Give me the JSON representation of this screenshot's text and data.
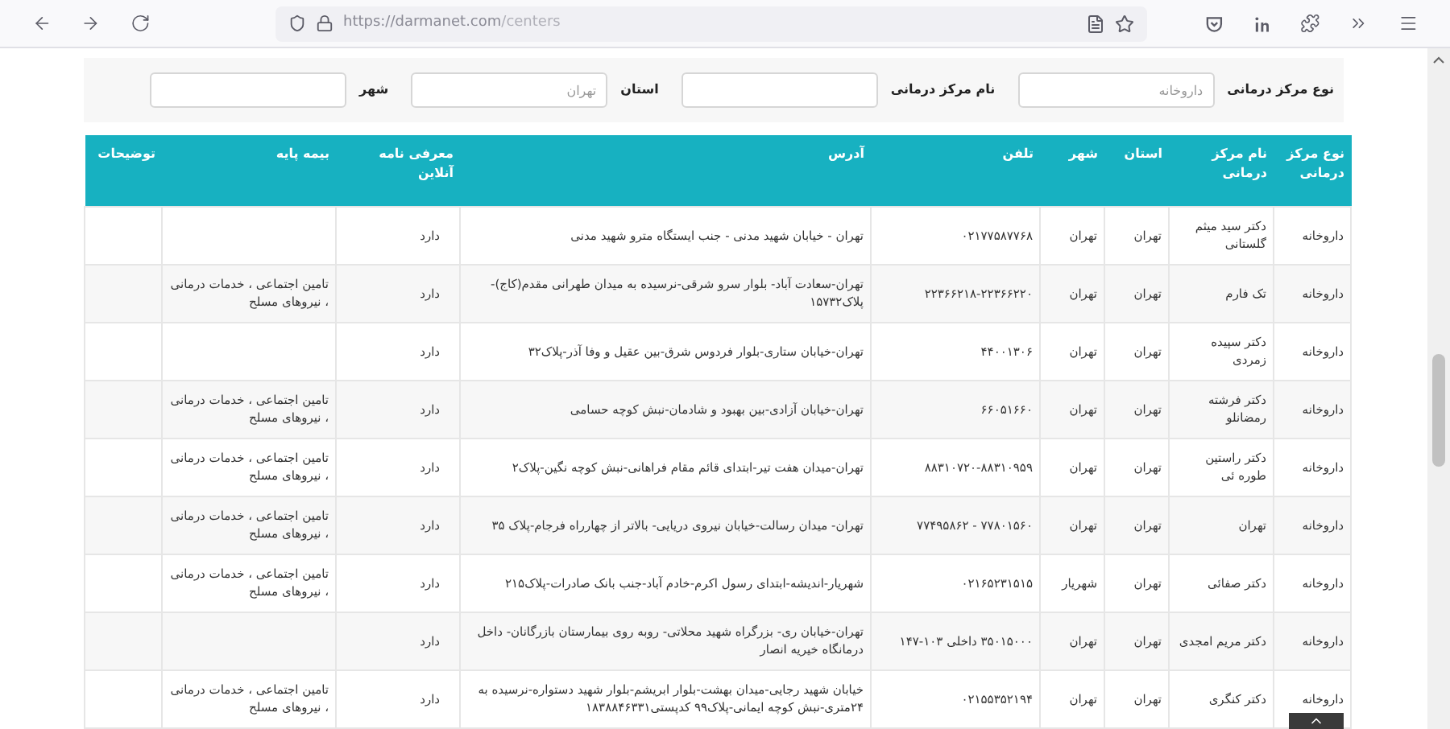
{
  "browser": {
    "url_host": "https://darmanet.com",
    "url_path": "/centers"
  },
  "filters": [
    {
      "label": "نوع مرکز درمانی",
      "placeholder": "داروخانه"
    },
    {
      "label": "نام مرکز درمانی"
    },
    {
      "label": "استان",
      "placeholder": "تهران"
    },
    {
      "label": "شهر"
    }
  ],
  "table": {
    "columns": [
      "نوع مرکز درمانی",
      "نام مرکز درمانی",
      "استان",
      "شهر",
      "تلفن",
      "آدرس",
      "معرفی نامه آنلاین",
      "بیمه پایه",
      "توضیحات"
    ],
    "rows": [
      {
        "type": "داروخانه",
        "name": "دکتر سید میثم گلستانی",
        "province": "تهران",
        "city": "تهران",
        "phone": "۰۲۱۷۷۵۸۷۷۶۸",
        "address": "تهران - خیابان شهید مدنی - جنب ایستگاه مترو شهید مدنی",
        "online": "دارد"
      },
      {
        "type": "داروخانه",
        "name": "تک فارم",
        "province": "تهران",
        "city": "تهران",
        "phone": "۲۲۳۶۶۲۱۸-۲۲۳۶۶۲۲۰",
        "address": "تهران-سعادت آباد- بلوار سرو شرقی-نرسیده به میدان طهرانی مقدم(کاج)-پلاک۱۵۷۳۲",
        "online": "دارد",
        "insurance": "تامین اجتماعی ، خدمات درمانی ، نیروهای مسلح"
      },
      {
        "type": "داروخانه",
        "name": "دکتر سپیده زمردی",
        "province": "تهران",
        "city": "تهران",
        "phone": "۴۴۰۰۱۳۰۶",
        "address": "تهران-خیابان ستاری-بلوار فردوس شرق-بین عقیل و وفا آذر-پلاک۳۲",
        "online": "دارد"
      },
      {
        "type": "داروخانه",
        "name": "دکتر فرشته رمضانلو",
        "province": "تهران",
        "city": "تهران",
        "phone": "۶۶۰۵۱۶۶۰",
        "address": "تهران-خیابان آزادی-بین بهبود و شادمان-نبش کوچه حسامی",
        "online": "دارد",
        "insurance": "تامین اجتماعی ، خدمات درمانی ، نیروهای مسلح"
      },
      {
        "type": "داروخانه",
        "name": "دکتر راستین طوره ئی",
        "province": "تهران",
        "city": "تهران",
        "phone": "۸۸۳۱۰۷۲۰-۸۸۳۱۰۹۵۹",
        "address": "تهران-میدان هفت تیر-ابتدای قائم مقام فراهانی-نبش کوچه نگین-پلاک۲",
        "online": "دارد",
        "insurance": "تامین اجتماعی ، خدمات درمانی ، نیروهای مسلح"
      },
      {
        "type": "داروخانه",
        "name": "تهران",
        "province": "تهران",
        "city": "تهران",
        "phone": "۷۷۸۰۱۵۶۰ - ۷۷۴۹۵۸۶۲",
        "address": "تهران- میدان رسالت-خیابان نیروی دریایی- بالاتر از چهارراه فرجام-پلاک ۳۵",
        "online": "دارد",
        "insurance": "تامین اجتماعی ، خدمات درمانی ، نیروهای مسلح"
      },
      {
        "type": "داروخانه",
        "name": "دکتر صفائی",
        "province": "تهران",
        "city": "شهریار",
        "phone": "۰۲۱۶۵۲۳۱۵۱۵",
        "address": "شهریار-اندیشه-ابتدای رسول اکرم-خادم آباد-جنب بانک صادرات-پلاک۲۱۵",
        "online": "دارد",
        "insurance": "تامین اجتماعی ، خدمات درمانی ، نیروهای مسلح"
      },
      {
        "type": "داروخانه",
        "name": "دکتر مریم امجدی",
        "province": "تهران",
        "city": "تهران",
        "phone": "۳۵۰۱۵۰۰۰ داخلی ۱۰۳-۱۴۷",
        "address": "تهران-خیابان ری- بزرگراه شهید محلاتی- روبه روی بیمارستان بازرگانان- داخل درمانگاه خیریه انصار",
        "online": "دارد"
      },
      {
        "type": "داروخانه",
        "name": "دکتر کنگری",
        "province": "تهران",
        "city": "تهران",
        "phone": "۰۲۱۵۵۳۵۲۱۹۴",
        "address": "خیابان شهید رجایی-میدان بهشت-بلوار ابریشم-بلوار شهید دستواره-نرسیده به ۲۴متری-نبش کوچه ایمانی-پلاک۹۹ کدپستی۱۸۳۸۸۴۶۳۳۱",
        "online": "دارد",
        "insurance": "تامین اجتماعی ، خدمات درمانی ، نیروهای مسلح"
      }
    ]
  }
}
